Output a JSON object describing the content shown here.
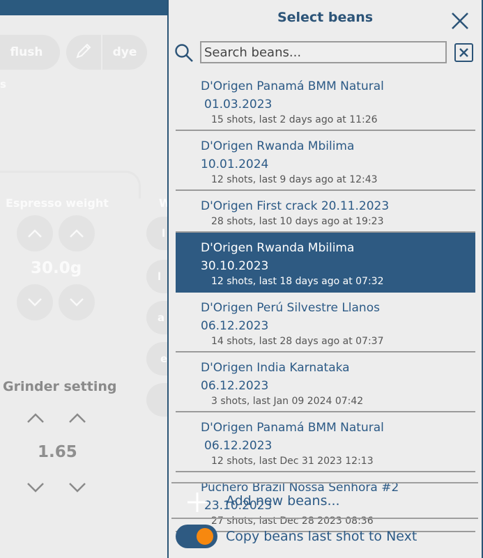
{
  "background": {
    "buttons": {
      "flush": "flush",
      "dye": "dye",
      "fragment": "s"
    },
    "espresso_weight": {
      "label": "Espresso weight",
      "value": "30.0g"
    },
    "partial_labels": {
      "w": "W",
      "l1": "l",
      "l2": "l",
      "a": "a",
      "e": "e"
    },
    "grinder": {
      "label": "Grinder setting",
      "value": "1.65"
    }
  },
  "dialog": {
    "title": "Select beans",
    "search": {
      "placeholder": "Search beans...",
      "value": ""
    },
    "beans": [
      {
        "name_line1": "D'Origen Panamá BMM Natural",
        "name_line2": "01.03.2023",
        "meta": "15 shots, last 2 days ago at 11:26",
        "selected": false
      },
      {
        "name_line1": "D'Origen Rwanda Mbilima 10.01.2024",
        "name_line2": "",
        "meta": "12 shots, last 9 days ago at 12:43",
        "selected": false
      },
      {
        "name_line1": "D'Origen First crack 20.11.2023",
        "name_line2": "",
        "meta": "28 shots, last 10 days ago at 19:23",
        "selected": false
      },
      {
        "name_line1": "D'Origen Rwanda Mbilima 30.10.2023",
        "name_line2": "",
        "meta": "12 shots, last 18 days ago at 07:32",
        "selected": true
      },
      {
        "name_line1": "D'Origen Perú Silvestre Llanos 06.12.2023",
        "name_line2": "",
        "meta": "14 shots, last 28 days ago at 07:37",
        "selected": false
      },
      {
        "name_line1": "D'Origen India Karnataka 06.12.2023",
        "name_line2": "",
        "meta": "3 shots, last Jan 09 2024 07:42",
        "selected": false
      },
      {
        "name_line1": "D'Origen Panamá BMM Natural",
        "name_line2": "06.12.2023",
        "meta": "12 shots, last Dec 31 2023 12:13",
        "selected": false
      },
      {
        "name_line1": "Puchero Brazil Nossa Senhora #2",
        "name_line2": "23.10.2023",
        "meta": "27 shots, last Dec 28 2023 08:36",
        "selected": false
      }
    ],
    "add_new_label": "Add new beans...",
    "copy_toggle": {
      "label": "Copy beans last shot to Next",
      "on": true
    }
  },
  "colors": {
    "accent": "#2e5a82",
    "toggle_knob": "#f7880f",
    "text_blue": "#2c5a86"
  },
  "icons": {
    "close": "close-icon",
    "search": "search-icon",
    "clear": "clear-search-icon",
    "add": "plus-icon",
    "edit": "pencil-icon"
  }
}
